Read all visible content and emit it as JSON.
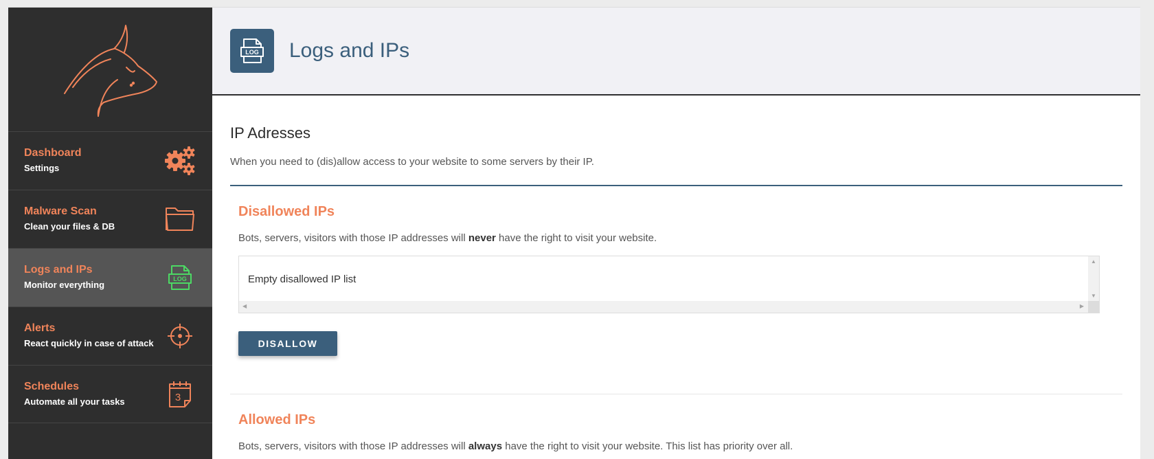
{
  "sidebar": {
    "items": [
      {
        "title": "Dashboard",
        "subtitle": "Settings",
        "icon": "gears-icon",
        "active": false
      },
      {
        "title": "Malware Scan",
        "subtitle": "Clean your files & DB",
        "icon": "folder-icon",
        "active": false
      },
      {
        "title": "Logs and IPs",
        "subtitle": "Monitor everything",
        "icon": "log-file-icon",
        "active": true
      },
      {
        "title": "Alerts",
        "subtitle": "React quickly in case of attack",
        "icon": "crosshair-icon",
        "active": false
      },
      {
        "title": "Schedules",
        "subtitle": "Automate all your tasks",
        "icon": "calendar-icon",
        "active": false
      }
    ],
    "calendar_day": "3"
  },
  "header": {
    "title": "Logs and IPs",
    "icon_label": "LOG"
  },
  "section": {
    "title": "IP Adresses",
    "description": "When you need to (dis)allow access to your website to some servers by their IP."
  },
  "disallowed": {
    "title": "Disallowed IPs",
    "desc_before": "Bots, servers, visitors with those IP addresses will ",
    "desc_bold": "never",
    "desc_after": " have the right to visit your website.",
    "list_empty_text": "Empty disallowed IP list",
    "button_label": "DISALLOW"
  },
  "allowed": {
    "title": "Allowed IPs",
    "desc_before": "Bots, servers, visitors with those IP addresses will ",
    "desc_bold": "always",
    "desc_after": " have the right to visit your website. This list has priority over all."
  },
  "colors": {
    "accent_orange": "#f0845a",
    "brand_blue": "#3b5f7c",
    "sidebar_bg": "#2e2e2e",
    "active_icon_green": "#4cd964"
  }
}
